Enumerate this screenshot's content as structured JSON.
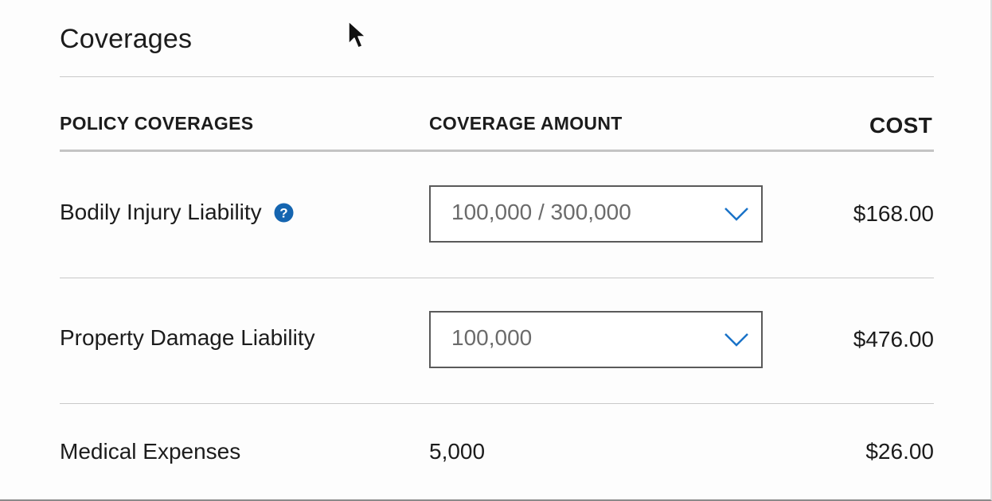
{
  "section": {
    "title": "Coverages"
  },
  "table": {
    "headers": {
      "policy": "POLICY COVERAGES",
      "amount": "COVERAGE AMOUNT",
      "cost": "COST"
    },
    "rows": [
      {
        "name": "Bodily Injury Liability",
        "has_help_icon": true,
        "amount": "100,000 / 300,000",
        "amount_type": "select",
        "cost": "$168.00"
      },
      {
        "name": "Property Damage Liability",
        "has_help_icon": false,
        "amount": "100,000",
        "amount_type": "select",
        "cost": "$476.00"
      },
      {
        "name": "Medical Expenses",
        "has_help_icon": false,
        "amount": "5,000",
        "amount_type": "static",
        "cost": "$26.00"
      }
    ]
  },
  "icons": {
    "help": "question-circle-icon",
    "dropdown": "chevron-down-icon",
    "cursor": "mouse-pointer-icon"
  },
  "colors": {
    "accent": "#1a73c8",
    "help_icon": "#1565b0",
    "text": "#1c1c1c",
    "select_text": "#6b6b6b",
    "select_border": "#5a5a5a",
    "divider": "#c9c9c9"
  }
}
